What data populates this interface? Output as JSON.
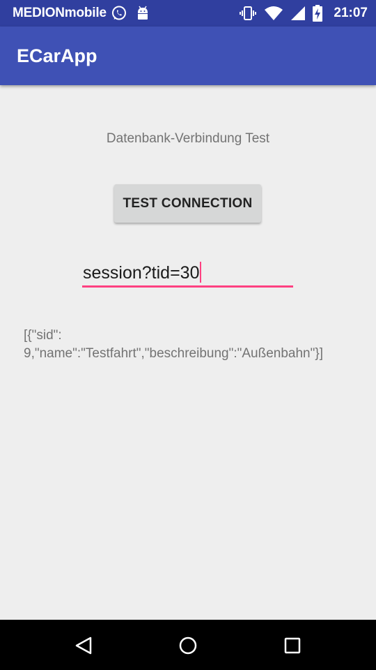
{
  "status_bar": {
    "carrier": "MEDIONmobile",
    "time": "21:07",
    "icons": [
      "whatsapp-icon",
      "android-debug-icon",
      "vibrate-icon",
      "wifi-icon",
      "signal-icon",
      "battery-charging-icon"
    ]
  },
  "app_bar": {
    "title": "ECarApp"
  },
  "main": {
    "heading": "Datenbank-Verbindung Test",
    "test_button_label": "TEST CONNECTION",
    "session_input_value": "session?tid=30",
    "result_text": "[{\"sid\":\n9,\"name\":\"Testfahrt\",\"beschreibung\":\"Außenbahn\"}]"
  },
  "nav_bar": {
    "icons": [
      "back-icon",
      "home-icon",
      "recents-icon"
    ]
  },
  "colors": {
    "status_bar": "#303f9f",
    "app_bar": "#3f51b5",
    "accent": "#ff4081",
    "background": "#eeeeee"
  }
}
